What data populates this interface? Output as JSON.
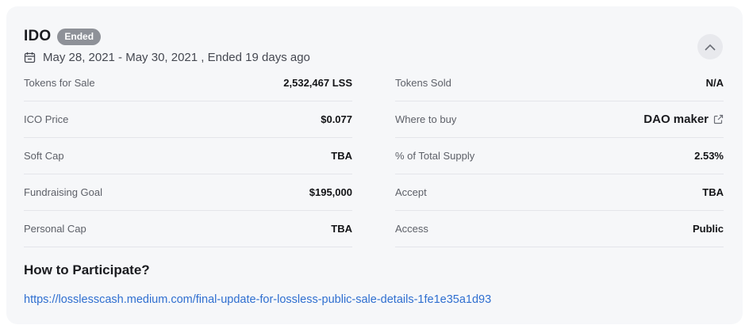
{
  "header": {
    "title": "IDO",
    "status_badge": "Ended",
    "date_range": "May 28, 2021 - May 30, 2021 , Ended 19 days ago",
    "collapse_icon": "chevron-up-icon",
    "calendar_icon": "calendar-icon"
  },
  "details": {
    "left": [
      {
        "label": "Tokens for Sale",
        "value": "2,532,467 LSS"
      },
      {
        "label": "ICO Price",
        "value": "$0.077"
      },
      {
        "label": "Soft Cap",
        "value": "TBA"
      },
      {
        "label": "Fundraising Goal",
        "value": "$195,000"
      },
      {
        "label": "Personal Cap",
        "value": "TBA"
      }
    ],
    "right": [
      {
        "label": "Tokens Sold",
        "value": "N/A"
      },
      {
        "label": "Where to buy",
        "value": "DAO maker"
      },
      {
        "label": "% of Total Supply",
        "value": "2.53%"
      },
      {
        "label": "Accept",
        "value": "TBA"
      },
      {
        "label": "Access",
        "value": "Public"
      }
    ]
  },
  "participate": {
    "heading": "How to Participate?",
    "link_text": "https://losslesscash.medium.com/final-update-for-lossless-public-sale-details-1fe1e35a1d93"
  },
  "colors": {
    "card_bg": "#f6f7f9",
    "badge_bg": "#8e9198",
    "link": "#2f6fd0"
  }
}
